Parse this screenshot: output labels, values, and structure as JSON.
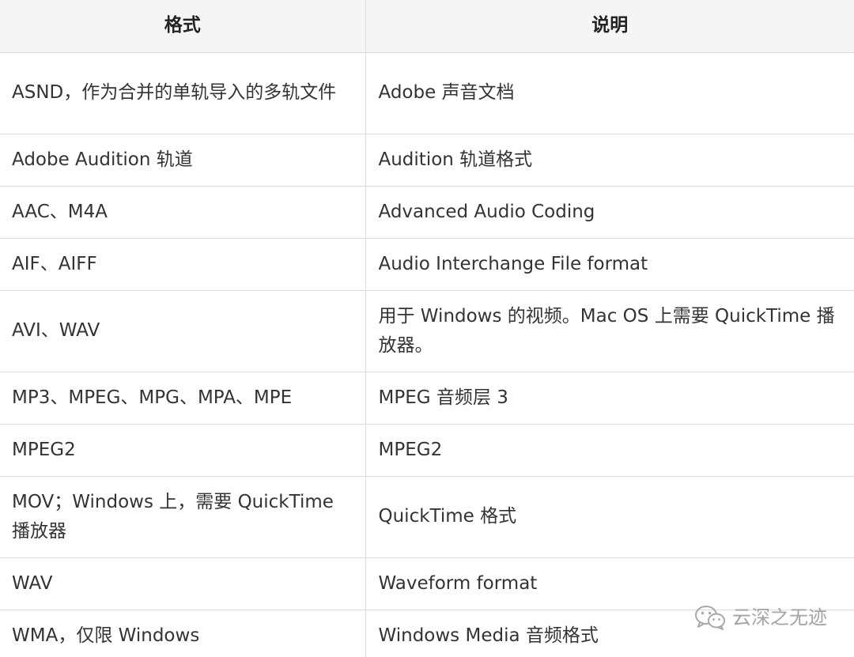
{
  "table": {
    "headers": [
      "格式",
      "说明"
    ],
    "rows": [
      {
        "format": "ASND，作为合并的单轨导入的多轨文件",
        "desc": "Adobe 声音文档"
      },
      {
        "format": "Adobe Audition 轨道",
        "desc": "Audition 轨道格式"
      },
      {
        "format": "AAC、M4A",
        "desc": "Advanced Audio Coding"
      },
      {
        "format": "AIF、AIFF",
        "desc": "Audio Interchange File format"
      },
      {
        "format": "AVI、WAV",
        "desc": "用于 Windows 的视频。Mac OS 上需要 QuickTime 播放器。"
      },
      {
        "format": "MP3、MPEG、MPG、MPA、MPE",
        "desc": "MPEG 音频层 3"
      },
      {
        "format": "MPEG2",
        "desc": "MPEG2"
      },
      {
        "format": "MOV；Windows 上，需要 QuickTime 播放器",
        "desc": "QuickTime 格式"
      },
      {
        "format": "WAV",
        "desc": "Waveform format"
      },
      {
        "format": "WMA，仅限 Windows",
        "desc": "Windows Media 音频格式"
      }
    ]
  },
  "watermark": {
    "icon": "wechat-icon",
    "text": "云深之无迹"
  }
}
